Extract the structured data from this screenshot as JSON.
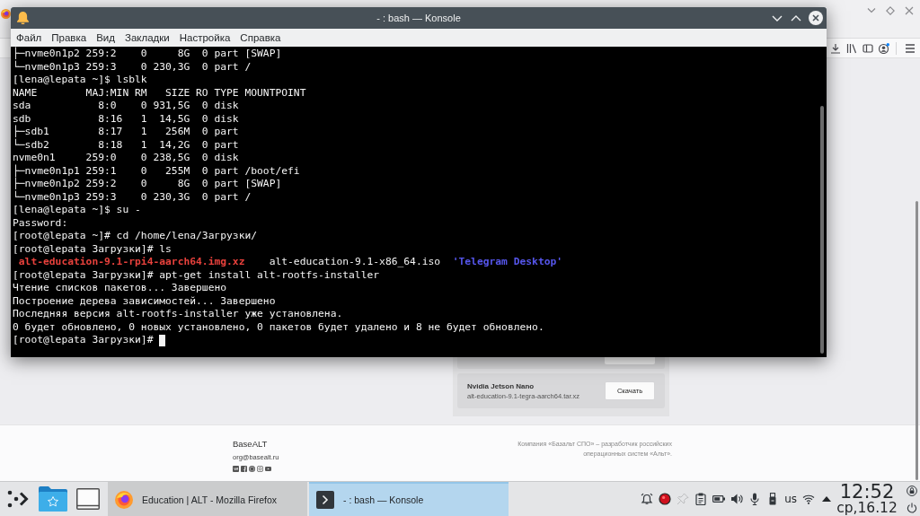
{
  "browser": {
    "page": {
      "downloads": [
        {
          "title": "Nvidia Jetson Nano",
          "file": "alt-education-9.1-tegra-aarch64.tar.xz",
          "button": "Скачать"
        }
      ]
    },
    "footer": {
      "brand": "BaseALT",
      "email": "org@basealt.ru",
      "about": "Компания «Базальт СПО» – разработчик российских операционных систем «Альт»."
    }
  },
  "konsole": {
    "title": "- : bash — Konsole",
    "menu": [
      "Файл",
      "Правка",
      "Вид",
      "Закладки",
      "Настройка",
      "Справка"
    ],
    "lines": [
      {
        "segments": [
          {
            "text": "├─nvme0n1p2 259:2    0     8G  0 part [SWAP]"
          }
        ]
      },
      {
        "segments": [
          {
            "text": "└─nvme0n1p3 259:3    0 230,3G  0 part /"
          }
        ]
      },
      {
        "segments": [
          {
            "text": "[lena@lepata ~]$ lsblk"
          }
        ]
      },
      {
        "segments": [
          {
            "text": "NAME        MAJ:MIN RM   SIZE RO TYPE MOUNTPOINT"
          }
        ]
      },
      {
        "segments": [
          {
            "text": "sda           8:0    0 931,5G  0 disk"
          }
        ]
      },
      {
        "segments": [
          {
            "text": "sdb           8:16   1  14,5G  0 disk"
          }
        ]
      },
      {
        "segments": [
          {
            "text": "├─sdb1        8:17   1   256M  0 part"
          }
        ]
      },
      {
        "segments": [
          {
            "text": "└─sdb2        8:18   1  14,2G  0 part"
          }
        ]
      },
      {
        "segments": [
          {
            "text": "nvme0n1     259:0    0 238,5G  0 disk"
          }
        ]
      },
      {
        "segments": [
          {
            "text": "├─nvme0n1p1 259:1    0   255M  0 part /boot/efi"
          }
        ]
      },
      {
        "segments": [
          {
            "text": "├─nvme0n1p2 259:2    0     8G  0 part [SWAP]"
          }
        ]
      },
      {
        "segments": [
          {
            "text": "└─nvme0n1p3 259:3    0 230,3G  0 part /"
          }
        ]
      },
      {
        "segments": [
          {
            "text": "[lena@lepata ~]$ su -"
          }
        ]
      },
      {
        "segments": [
          {
            "text": "Password:"
          }
        ]
      },
      {
        "segments": [
          {
            "text": "[root@lepata ~]# cd /home/lena/Загрузки/"
          }
        ]
      },
      {
        "segments": [
          {
            "text": "[root@lepata Загрузки]# ls"
          }
        ]
      },
      {
        "segments": [
          {
            "text": " alt-education-9.1-rpi4-aarch64.img.xz",
            "color": "#e8413c"
          },
          {
            "text": "    alt-education-9.1-x86_64.iso  "
          },
          {
            "text": "'Telegram Desktop'",
            "color": "#5656ec"
          }
        ]
      },
      {
        "segments": [
          {
            "text": "[root@lepata Загрузки]# apt-get install alt-rootfs-installer"
          }
        ]
      },
      {
        "segments": [
          {
            "text": "Чтение списков пакетов... Завершено"
          }
        ]
      },
      {
        "segments": [
          {
            "text": "Построение дерева зависимостей... Завершено"
          }
        ]
      },
      {
        "segments": [
          {
            "text": "Последняя версия alt-rootfs-installer уже установлена."
          }
        ]
      },
      {
        "segments": [
          {
            "text": "0 будет обновлено, 0 новых установлено, 0 пакетов будет удалено и 8 не будет обновлено."
          }
        ]
      },
      {
        "segments": [
          {
            "text": "[root@lepata Загрузки]#"
          }
        ]
      }
    ]
  },
  "taskbar": {
    "tasks": [
      {
        "label": "Education | ALT - Mozilla Firefox",
        "kind": "browser",
        "selected": false
      },
      {
        "label": "- : bash — Konsole",
        "kind": "terminal",
        "selected": true
      }
    ],
    "keyboard_layout": "us",
    "clock": {
      "time": "12:52",
      "date": "ср,16.12"
    }
  }
}
